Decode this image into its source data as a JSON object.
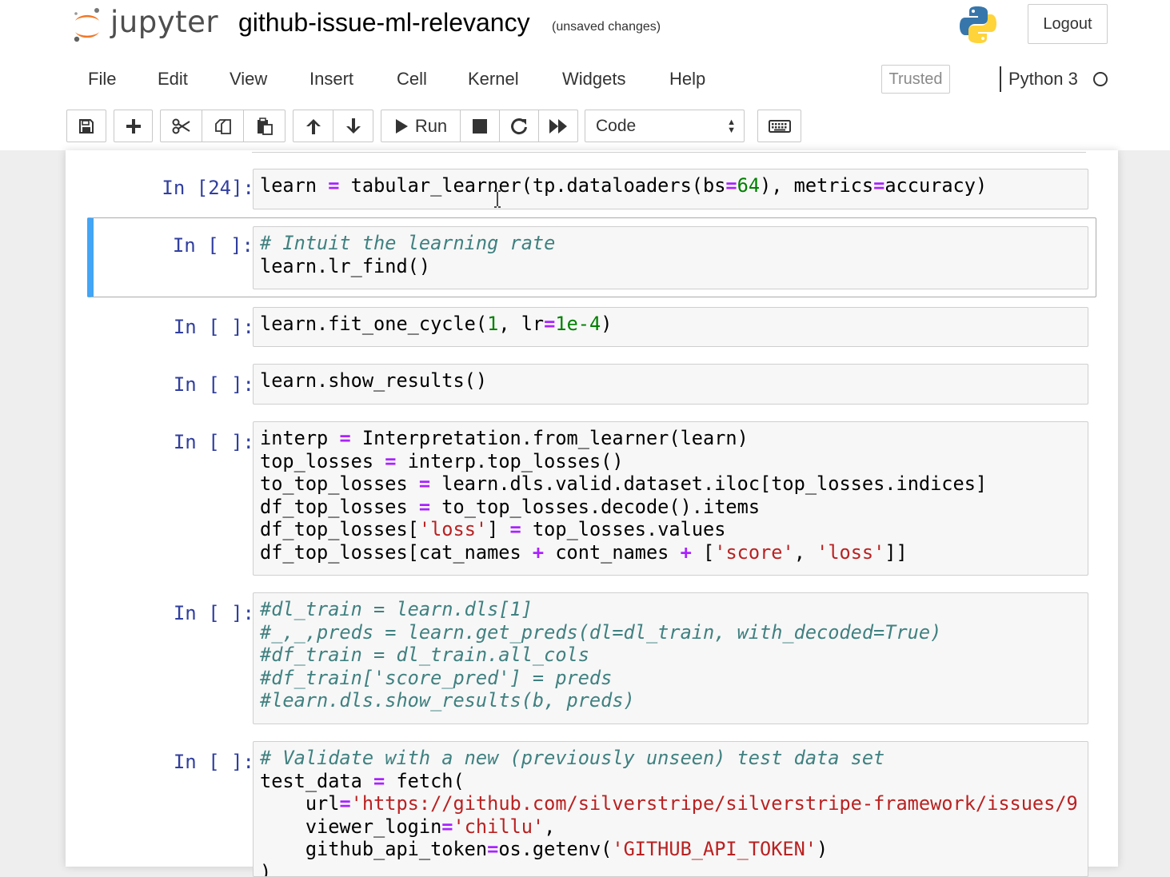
{
  "header": {
    "logo_text": "jupyter",
    "notebook_name": "github-issue-ml-relevancy",
    "save_status": "(unsaved changes)",
    "logout_label": "Logout"
  },
  "menu": {
    "items": [
      "File",
      "Edit",
      "View",
      "Insert",
      "Cell",
      "Kernel",
      "Widgets",
      "Help"
    ],
    "trusted_label": "Trusted",
    "kernel_name": "Python 3"
  },
  "toolbar": {
    "run_label": "Run",
    "cell_type": "Code",
    "icons": [
      "save-icon",
      "plus-icon",
      "cut-icon",
      "copy-icon",
      "paste-icon",
      "arrow-up-icon",
      "arrow-down-icon",
      "run-icon",
      "stop-icon",
      "restart-icon",
      "fast-forward-icon",
      "keyboard-icon"
    ]
  },
  "colors": {
    "prompt": "#303f9f",
    "selected_border": "#42a5f5",
    "operator": "#aa22ff",
    "number": "#008000",
    "string": "#ba2121",
    "comment": "#408080"
  },
  "cells": [
    {
      "prompt": "In [24]:",
      "selected": false,
      "lines": [
        [
          [
            "learn ",
            ""
          ],
          [
            "=",
            "o"
          ],
          [
            " tabular_learner(tp.dataloaders(bs",
            ""
          ],
          [
            "=",
            "o"
          ],
          [
            "64",
            "n"
          ],
          [
            "), metrics",
            ""
          ],
          [
            "=",
            "o"
          ],
          [
            "accuracy)",
            ""
          ]
        ]
      ]
    },
    {
      "prompt": "In [ ]:",
      "selected": true,
      "lines": [
        [
          [
            "# Intuit the learning rate",
            "c"
          ]
        ],
        [
          [
            "learn.lr_find()",
            ""
          ]
        ]
      ]
    },
    {
      "prompt": "In [ ]:",
      "selected": false,
      "lines": [
        [
          [
            "learn.fit_one_cycle(",
            ""
          ],
          [
            "1",
            "n"
          ],
          [
            ", lr",
            ""
          ],
          [
            "=",
            "o"
          ],
          [
            "1e-4",
            "n"
          ],
          [
            ")",
            ""
          ]
        ]
      ]
    },
    {
      "prompt": "In [ ]:",
      "selected": false,
      "lines": [
        [
          [
            "learn.show_results()",
            ""
          ]
        ]
      ]
    },
    {
      "prompt": "In [ ]:",
      "selected": false,
      "lines": [
        [
          [
            "interp ",
            ""
          ],
          [
            "=",
            "o"
          ],
          [
            " Interpretation.from_learner(learn)",
            ""
          ]
        ],
        [
          [
            "top_losses ",
            ""
          ],
          [
            "=",
            "o"
          ],
          [
            " interp.top_losses()",
            ""
          ]
        ],
        [
          [
            "to_top_losses ",
            ""
          ],
          [
            "=",
            "o"
          ],
          [
            " learn.dls.valid.dataset.iloc[top_losses.indices]",
            ""
          ]
        ],
        [
          [
            "df_top_losses ",
            ""
          ],
          [
            "=",
            "o"
          ],
          [
            " to_top_losses.decode().items",
            ""
          ]
        ],
        [
          [
            "df_top_losses[",
            ""
          ],
          [
            "'loss'",
            "s"
          ],
          [
            "] ",
            ""
          ],
          [
            "=",
            "o"
          ],
          [
            " top_losses.values",
            ""
          ]
        ],
        [
          [
            "df_top_losses[cat_names ",
            ""
          ],
          [
            "+",
            "o"
          ],
          [
            " cont_names ",
            ""
          ],
          [
            "+",
            "o"
          ],
          [
            " [",
            ""
          ],
          [
            "'score'",
            "s"
          ],
          [
            ", ",
            ""
          ],
          [
            "'loss'",
            "s"
          ],
          [
            "]]",
            ""
          ]
        ]
      ]
    },
    {
      "prompt": "In [ ]:",
      "selected": false,
      "lines": [
        [
          [
            "#dl_train = learn.dls[1]",
            "c"
          ]
        ],
        [
          [
            "#_,_,preds = learn.get_preds(dl=dl_train, with_decoded=True)",
            "c"
          ]
        ],
        [
          [
            "#df_train = dl_train.all_cols",
            "c"
          ]
        ],
        [
          [
            "#df_train['score_pred'] = preds",
            "c"
          ]
        ],
        [
          [
            "#learn.dls.show_results(b, preds)",
            "c"
          ]
        ]
      ]
    },
    {
      "prompt": "In [ ]:",
      "selected": false,
      "lines": [
        [
          [
            "# Validate with a new (previously unseen) test data set",
            "c"
          ]
        ],
        [
          [
            "test_data ",
            ""
          ],
          [
            "=",
            "o"
          ],
          [
            " fetch(",
            ""
          ]
        ],
        [
          [
            "    url",
            ""
          ],
          [
            "=",
            "o"
          ],
          [
            "'https://github.com/silverstripe/silverstripe-framework/issues/9",
            "s"
          ]
        ],
        [
          [
            "    viewer_login",
            ""
          ],
          [
            "=",
            "o"
          ],
          [
            "'chillu'",
            "s"
          ],
          [
            ",",
            ""
          ]
        ],
        [
          [
            "    github_api_token",
            ""
          ],
          [
            "=",
            "o"
          ],
          [
            "os.getenv(",
            ""
          ],
          [
            "'GITHUB_API_TOKEN'",
            "s"
          ],
          [
            ")",
            ""
          ]
        ],
        [
          [
            ")",
            ""
          ]
        ]
      ]
    }
  ]
}
